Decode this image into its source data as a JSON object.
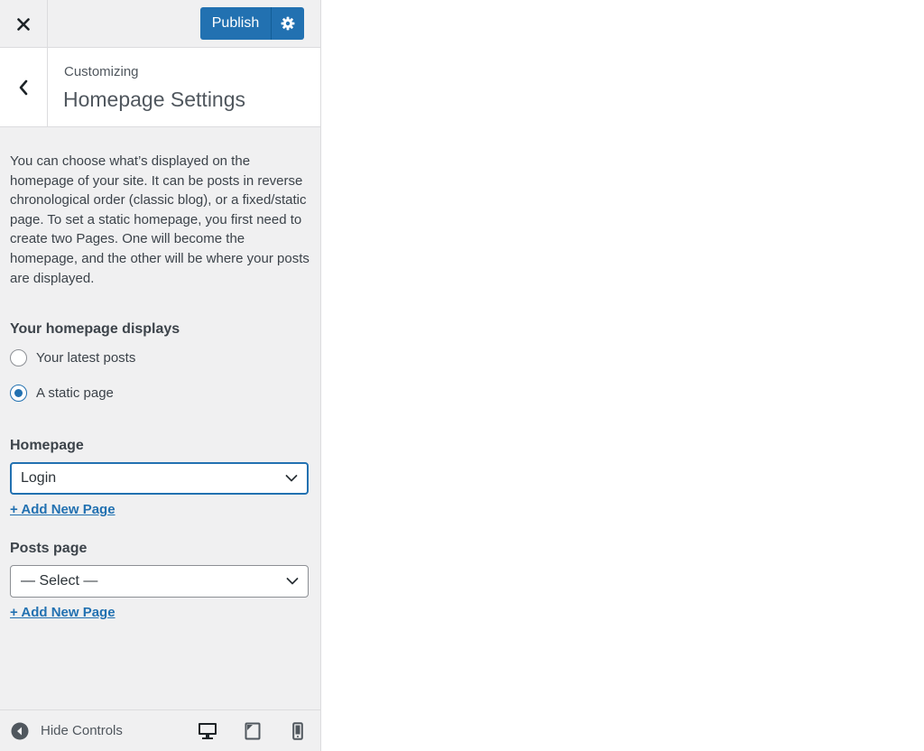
{
  "header": {
    "close_icon": "close-icon",
    "publish_label": "Publish",
    "settings_icon": "gear-icon",
    "accent_color": "#2271b1"
  },
  "section": {
    "breadcrumb": "Customizing",
    "title": "Homepage Settings",
    "back_icon": "chevron-left-icon"
  },
  "content": {
    "description": "You can choose what’s displayed on the homepage of your site. It can be posts in reverse chronological order (classic blog), or a fixed/static page. To set a static homepage, you first need to create two Pages. One will become the homepage, and the other will be where your posts are displayed.",
    "homepage_displays": {
      "label": "Your homepage displays",
      "options": [
        {
          "label": "Your latest posts",
          "checked": false
        },
        {
          "label": "A static page",
          "checked": true
        }
      ]
    },
    "homepage": {
      "label": "Homepage",
      "selected": "Login",
      "add_link": "+ Add New Page"
    },
    "posts_page": {
      "label": "Posts page",
      "selected": "— Select —",
      "add_link": "+ Add New Page"
    }
  },
  "footer": {
    "hide_controls_label": "Hide Controls",
    "hide_controls_icon": "collapse-arrow-icon",
    "devices": [
      "desktop-icon",
      "tablet-icon",
      "mobile-icon"
    ]
  }
}
